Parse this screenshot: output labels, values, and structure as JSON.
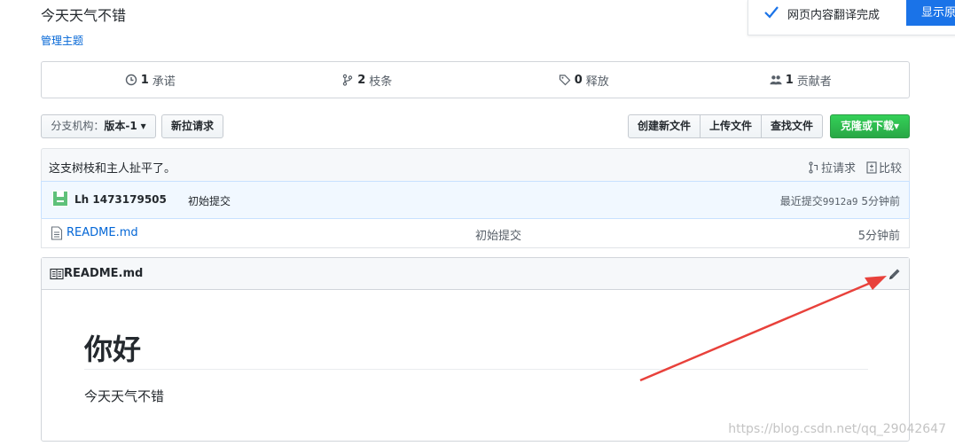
{
  "repo": {
    "description": "今天天气不错",
    "manage_topics": "管理主题"
  },
  "translate_popup": {
    "message": "网页内容翻译完成",
    "show_original": "显示原",
    "accent": "#1a73e8"
  },
  "summary": {
    "commits_count": "1",
    "commits_label": "承诺",
    "branches_count": "2",
    "branches_label": "枝条",
    "releases_count": "0",
    "releases_label": "释放",
    "contributors_count": "1",
    "contributors_label": "贡献者"
  },
  "toolbar": {
    "branch_label": "分支机构：",
    "branch_value": "版本-1",
    "new_pr": "新拉请求",
    "create_file": "创建新文件",
    "upload_files": "上传文件",
    "find_file": "查找文件",
    "clone_download": "克隆或下载",
    "clone_color": "#28a745"
  },
  "branch_info": {
    "status": "这支树枝和主人扯平了。",
    "pull_request": "拉请求",
    "compare": "比较"
  },
  "commit": {
    "author": "Lh 1473179505",
    "message": "初始提交",
    "latest_label": "最近提交",
    "sha": "9912a9",
    "age": "5分钟前"
  },
  "files": [
    {
      "name": "README.md",
      "message": "初始提交",
      "age": "5分钟前",
      "icon": "file-icon"
    }
  ],
  "readme": {
    "title": "README.md",
    "heading": "你好",
    "body": "今天天气不错"
  },
  "watermark": "https://blog.csdn.net/qq_29042647",
  "annotation": {
    "arrow_color": "#e8413b"
  }
}
